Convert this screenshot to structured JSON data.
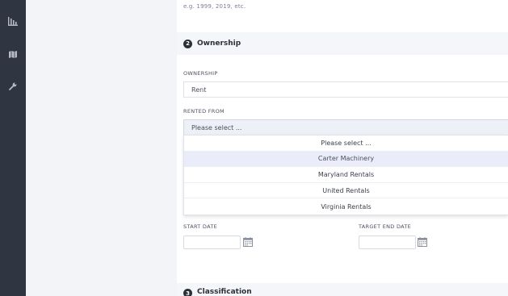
{
  "sidebar": {
    "icons": [
      "bar-chart-icon",
      "map-icon",
      "wrench-icon"
    ]
  },
  "year_hint": "e.g. 1999, 2019, etc.",
  "ownership_section": {
    "number": "2",
    "title": "Ownership"
  },
  "ownership_field": {
    "label": "OWNERSHIP",
    "value": "Rent"
  },
  "rented_from_field": {
    "label": "RENTED FROM",
    "value": "Please select ..."
  },
  "rented_from_options": [
    "Please select ...",
    "Carter Machinery",
    "Maryland Rentals",
    "United Rentals",
    "Virginia Rentals"
  ],
  "hovered_option": "Carter Machinery",
  "start_date": {
    "label": "START DATE",
    "value": ""
  },
  "target_end_date": {
    "label": "TARGET END DATE",
    "value": ""
  },
  "classification_section": {
    "number": "3",
    "title": "Classification"
  },
  "colors": {
    "sidebar": "#2f3541",
    "page_background": "#f3f4f8",
    "hover_highlight": "#eaedf9"
  }
}
